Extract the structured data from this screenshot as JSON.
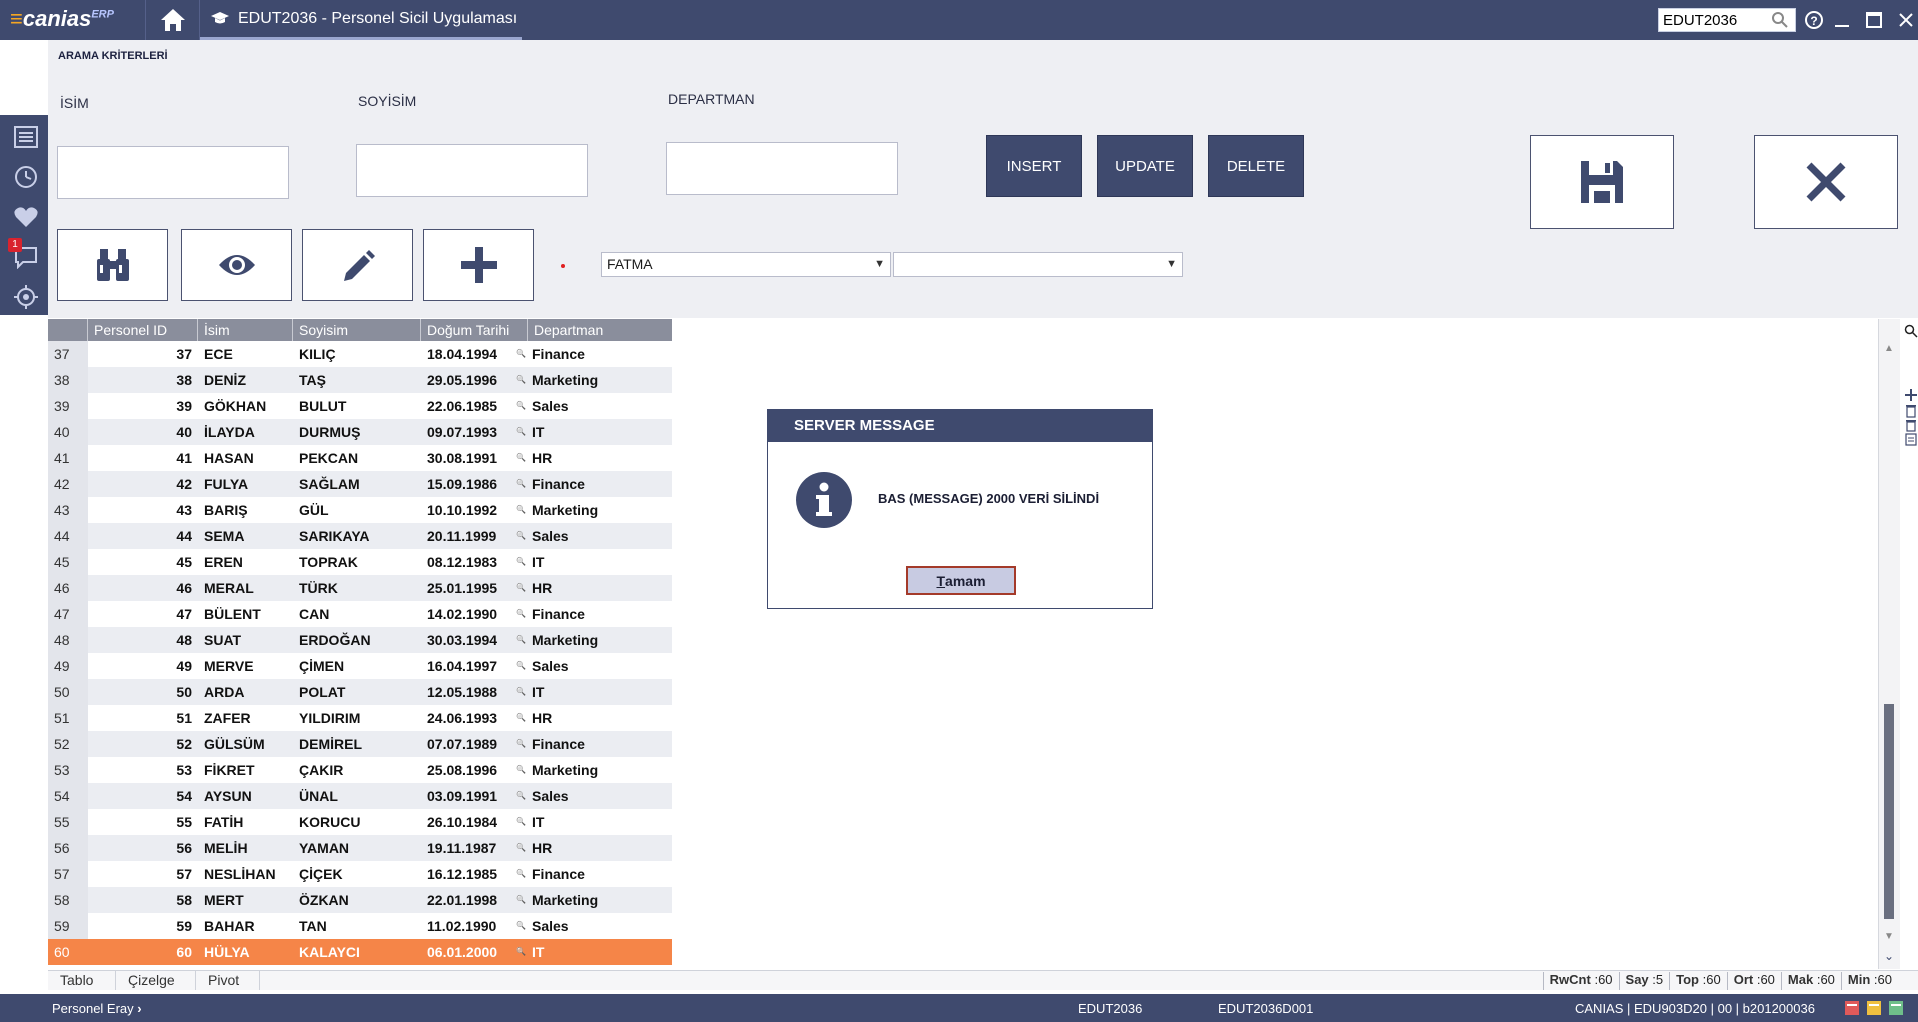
{
  "app": {
    "logo_text": "canias",
    "logo_erp": "ERP",
    "tab_title": "EDUT2036 - Personel Sicil Uygulaması",
    "search_value": "EDUT2036"
  },
  "criteria": {
    "title": "ARAMA KRİTERLERİ",
    "labels": {
      "isim": "İSİM",
      "soyisim": "SOYİSİM",
      "departman": "DEPARTMAN"
    },
    "buttons": {
      "insert": "INSERT",
      "update": "UPDATE",
      "delete": "DELETE"
    },
    "combo1": "FATMA",
    "combo2": ""
  },
  "rail": {
    "badge": "1"
  },
  "grid": {
    "headers": [
      "Personel ID",
      "İsim",
      "Soyisim",
      "Doğum Tarihi",
      "Departman"
    ],
    "rows": [
      {
        "rn": "37",
        "id": "37",
        "name": "ECE",
        "sur": "KILIÇ",
        "dob": "18.04.1994",
        "dep": "Finance"
      },
      {
        "rn": "38",
        "id": "38",
        "name": "DENİZ",
        "sur": "TAŞ",
        "dob": "29.05.1996",
        "dep": "Marketing"
      },
      {
        "rn": "39",
        "id": "39",
        "name": "GÖKHAN",
        "sur": "BULUT",
        "dob": "22.06.1985",
        "dep": "Sales"
      },
      {
        "rn": "40",
        "id": "40",
        "name": "İLAYDA",
        "sur": "DURMUŞ",
        "dob": "09.07.1993",
        "dep": "IT"
      },
      {
        "rn": "41",
        "id": "41",
        "name": "HASAN",
        "sur": "PEKCAN",
        "dob": "30.08.1991",
        "dep": "HR"
      },
      {
        "rn": "42",
        "id": "42",
        "name": "FULYA",
        "sur": "SAĞLAM",
        "dob": "15.09.1986",
        "dep": "Finance"
      },
      {
        "rn": "43",
        "id": "43",
        "name": "BARIŞ",
        "sur": "GÜL",
        "dob": "10.10.1992",
        "dep": "Marketing"
      },
      {
        "rn": "44",
        "id": "44",
        "name": "SEMA",
        "sur": "SARIKAYA",
        "dob": "20.11.1999",
        "dep": "Sales"
      },
      {
        "rn": "45",
        "id": "45",
        "name": "EREN",
        "sur": "TOPRAK",
        "dob": "08.12.1983",
        "dep": "IT"
      },
      {
        "rn": "46",
        "id": "46",
        "name": "MERAL",
        "sur": "TÜRK",
        "dob": "25.01.1995",
        "dep": "HR"
      },
      {
        "rn": "47",
        "id": "47",
        "name": "BÜLENT",
        "sur": "CAN",
        "dob": "14.02.1990",
        "dep": "Finance"
      },
      {
        "rn": "48",
        "id": "48",
        "name": "SUAT",
        "sur": "ERDOĞAN",
        "dob": "30.03.1994",
        "dep": "Marketing"
      },
      {
        "rn": "49",
        "id": "49",
        "name": "MERVE",
        "sur": "ÇİMEN",
        "dob": "16.04.1997",
        "dep": "Sales"
      },
      {
        "rn": "50",
        "id": "50",
        "name": "ARDA",
        "sur": "POLAT",
        "dob": "12.05.1988",
        "dep": "IT"
      },
      {
        "rn": "51",
        "id": "51",
        "name": "ZAFER",
        "sur": "YILDIRIM",
        "dob": "24.06.1993",
        "dep": "HR"
      },
      {
        "rn": "52",
        "id": "52",
        "name": "GÜLSÜM",
        "sur": "DEMİREL",
        "dob": "07.07.1989",
        "dep": "Finance"
      },
      {
        "rn": "53",
        "id": "53",
        "name": "FİKRET",
        "sur": "ÇAKIR",
        "dob": "25.08.1996",
        "dep": "Marketing"
      },
      {
        "rn": "54",
        "id": "54",
        "name": "AYSUN",
        "sur": "ÜNAL",
        "dob": "03.09.1991",
        "dep": "Sales"
      },
      {
        "rn": "55",
        "id": "55",
        "name": "FATİH",
        "sur": "KORUCU",
        "dob": "26.10.1984",
        "dep": "IT"
      },
      {
        "rn": "56",
        "id": "56",
        "name": "MELİH",
        "sur": "YAMAN",
        "dob": "19.11.1987",
        "dep": "HR"
      },
      {
        "rn": "57",
        "id": "57",
        "name": "NESLİHAN",
        "sur": "ÇİÇEK",
        "dob": "16.12.1985",
        "dep": "Finance"
      },
      {
        "rn": "58",
        "id": "58",
        "name": "MERT",
        "sur": "ÖZKAN",
        "dob": "22.01.1998",
        "dep": "Marketing"
      },
      {
        "rn": "59",
        "id": "59",
        "name": "BAHAR",
        "sur": "TAN",
        "dob": "11.02.1990",
        "dep": "Sales"
      },
      {
        "rn": "60",
        "id": "60",
        "name": "HÜLYA",
        "sur": "KALAYCI",
        "dob": "06.01.2000",
        "dep": "IT"
      }
    ],
    "selected_row": "60"
  },
  "bottom_tabs": [
    "Tablo",
    "Çizelge",
    "Pivot"
  ],
  "stats": [
    {
      "label": "RwCnt",
      "value": ":60"
    },
    {
      "label": "Say",
      "value": ":5"
    },
    {
      "label": "Top",
      "value": ":60"
    },
    {
      "label": "Ort",
      "value": ":60"
    },
    {
      "label": "Mak",
      "value": ":60"
    },
    {
      "label": "Min",
      "value": ":60"
    }
  ],
  "footer": {
    "user": "Personel Eray",
    "prog": "EDUT2036",
    "form": "EDUT2036D001",
    "sys": "CANIAS | EDU903D20 | 00 | b201200036"
  },
  "dialog": {
    "title": "SERVER MESSAGE",
    "message": "BAS (MESSAGE) 2000 VERİ SİLİNDİ",
    "ok_u": "T",
    "ok_rest": "amam"
  },
  "colors": {
    "primary": "#3f4a6e",
    "selected_row": "#f58548",
    "header": "#8a8e9c"
  }
}
